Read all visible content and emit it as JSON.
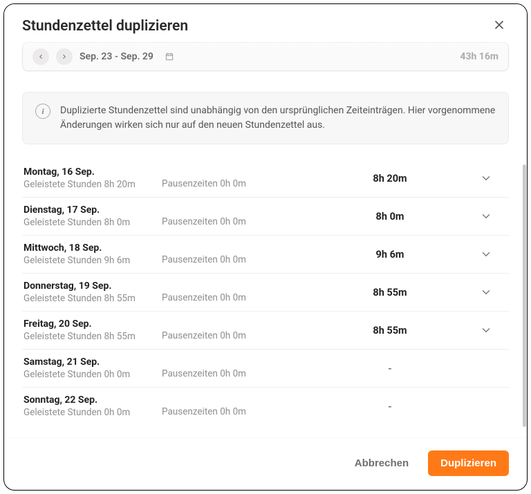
{
  "header": {
    "title": "Stundenzettel duplizieren"
  },
  "weekSelector": {
    "range": "Sep. 23 - Sep. 29",
    "total": "43h 16m"
  },
  "info": {
    "text": "Duplizierte Stundenzettel sind unabhängig von den ursprünglichen Zeiteinträgen. Hier vorgenommene Änderungen wirken sich nur auf den neuen Stundenzettel aus."
  },
  "labels": {
    "hours_prefix": "Geleistete Stunden",
    "breaks_prefix": "Pausenzeiten"
  },
  "days": [
    {
      "name": "Montag, 16 Sep.",
      "hours": "8h 20m",
      "breaks": "0h 0m",
      "total": "8h 20m",
      "expandable": true
    },
    {
      "name": "Dienstag, 17 Sep.",
      "hours": "8h 0m",
      "breaks": "0h 0m",
      "total": "8h 0m",
      "expandable": true
    },
    {
      "name": "Mittwoch, 18 Sep.",
      "hours": "9h 6m",
      "breaks": "0h 0m",
      "total": "9h 6m",
      "expandable": true
    },
    {
      "name": "Donnerstag, 19 Sep.",
      "hours": "8h 55m",
      "breaks": "0h 0m",
      "total": "8h 55m",
      "expandable": true
    },
    {
      "name": "Freitag, 20 Sep.",
      "hours": "8h 55m",
      "breaks": "0h 0m",
      "total": "8h 55m",
      "expandable": true
    },
    {
      "name": "Samstag, 21 Sep.",
      "hours": "0h 0m",
      "breaks": "0h 0m",
      "total": "-",
      "expandable": false
    },
    {
      "name": "Sonntag, 22 Sep.",
      "hours": "0h 0m",
      "breaks": "0h 0m",
      "total": "-",
      "expandable": false
    }
  ],
  "footer": {
    "cancel": "Abbrechen",
    "confirm": "Duplizieren"
  }
}
